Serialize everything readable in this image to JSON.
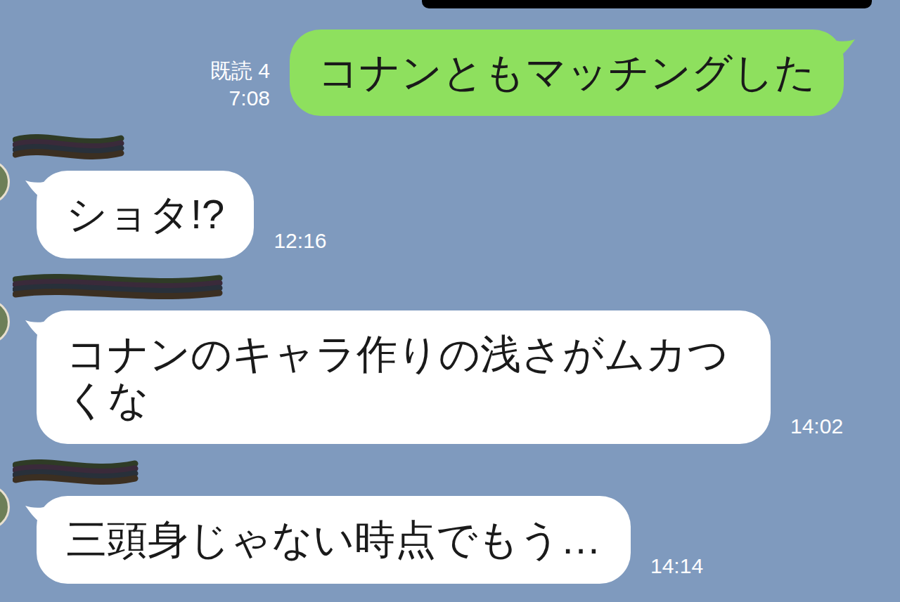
{
  "messages": [
    {
      "kind": "sent",
      "text": "コナンともマッチングした",
      "read": "既読 4",
      "time": "7:08"
    },
    {
      "kind": "received",
      "text": "ショタ!?",
      "time": "12:16"
    },
    {
      "kind": "received",
      "text": "コナンのキャラ作りの浅さがムカつくな",
      "time": "14:02"
    },
    {
      "kind": "received",
      "text": "三頭身じゃない時点でもう…",
      "time": "14:14"
    }
  ]
}
